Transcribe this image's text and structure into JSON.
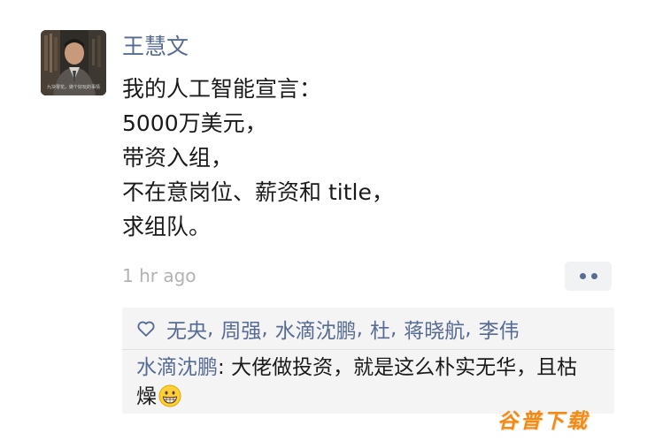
{
  "post": {
    "author": "王慧文",
    "avatar_caption": "九块零花，做个好玩的事情",
    "lines": [
      "我的人工智能宣言：",
      "5000万美元，",
      "带资入组，",
      "不在意岗位、薪资和 title，",
      "求组队。"
    ],
    "timestamp": "1 hr ago"
  },
  "likes": {
    "icon": "heart-outline-icon",
    "names": [
      "无央",
      "周强",
      "水滴沈鹏",
      "杜",
      "蒋晓航",
      "李伟"
    ],
    "separator": ","
  },
  "comments": [
    {
      "author": "水滴沈鹏",
      "separator": ": ",
      "text": "大佬做投资，就是这么朴实无华，且枯燥",
      "emoji": "grinning-face-icon"
    }
  ],
  "watermark": {
    "text": "谷普下载"
  },
  "colors": {
    "link": "#576b95",
    "text": "#1a1a1a",
    "muted": "#b2b2b2",
    "panel": "#f4f4f4",
    "watermark": "#f28a1a"
  }
}
